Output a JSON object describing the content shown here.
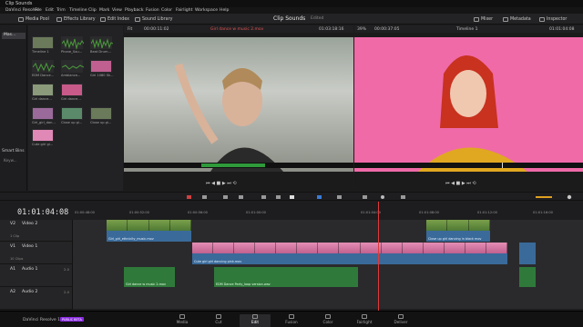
{
  "window": {
    "title": "Clip Sounds"
  },
  "menu": [
    "DaVinci Resolve",
    "File",
    "Edit",
    "Trim",
    "Timeline",
    "Clip",
    "Mark",
    "View",
    "Playback",
    "Fusion",
    "Color",
    "Fairlight",
    "Workspace",
    "Help"
  ],
  "toolbar": {
    "media_pool": "Media Pool",
    "effects_library": "Effects Library",
    "edit_index": "Edit Index",
    "sound_library": "Sound Library",
    "project_title": "Clip Sounds",
    "edited": "Edited",
    "mixer": "Mixer",
    "metadata": "Metadata",
    "inspector": "Inspector"
  },
  "media_pool": {
    "bin_label": "Mas...",
    "smart_bins": "Smart Bins",
    "keywords": "Keyw...",
    "clips": [
      {
        "label": "Timeline 1",
        "color": "#6b7a5a"
      },
      {
        "label": "Phone_Sou...",
        "color": "#4a8a3a"
      },
      {
        "label": "Beat Drum...",
        "color": "#4a8a3a"
      },
      {
        "label": "Girl 1080 Sk...",
        "color": "#c06090"
      },
      {
        "label": "EDM Dance...",
        "color": "#4a8a3a"
      },
      {
        "label": "Ambiance...",
        "color": "#5a6a4a"
      },
      {
        "label": "Girl dance...",
        "color": "#8a9a7a"
      },
      {
        "label": "Girl dance...",
        "color": "#c85a8a"
      },
      {
        "label": "Girl_girl_dan...",
        "color": "#9a6a9a"
      },
      {
        "label": "Close up gi...",
        "color": "#5a8a6a"
      },
      {
        "label": "Close up gi...",
        "color": "#6a7a5a"
      },
      {
        "label": "Cute girl gi...",
        "color": "#e088b6"
      }
    ]
  },
  "source_viewer": {
    "zoom": "Fit",
    "tc_in": "00:00:11:02",
    "clip_name": "Girl dance w music 2.mov",
    "tc_out": "01:03:18:16"
  },
  "timeline_viewer": {
    "zoom": "39%",
    "tc_in": "00:00:37:05",
    "timeline_name": "Timeline 1",
    "tc_out": "01:01:04:08"
  },
  "timeline": {
    "timecode": "01:01:04:08",
    "ruler": [
      "01:00:48:00",
      "01:00:52:00",
      "01:00:56:00",
      "01:01:00:00",
      "01:01:04:00",
      "01:01:08:00",
      "01:01:12:00",
      "01:01:16:00"
    ],
    "tracks": [
      {
        "code": "V2",
        "name": "Video 2",
        "count": "1 Clip",
        "num": ""
      },
      {
        "code": "V1",
        "name": "Video 1",
        "count": "10 Clips",
        "num": ""
      },
      {
        "code": "A1",
        "name": "Audio 1",
        "count": "",
        "num": "2.0"
      },
      {
        "code": "A2",
        "name": "Audio 2",
        "count": "",
        "num": "2.0"
      }
    ],
    "clips": {
      "v2a": "Girl_girl_ethnicity_music.mov",
      "v2b": "Close up girl dancing in black mov",
      "v1": "Cute girl girl dancing pink.mov",
      "a1a": "Girl dance w music 2.mov",
      "a1b": "EDM Dance Party_loop version.wav"
    }
  },
  "pages": [
    "Media",
    "Cut",
    "Edit",
    "Fusion",
    "Color",
    "Fairlight",
    "Deliver"
  ],
  "active_page": "Edit",
  "brand": {
    "name": "DaVinci Resolve 16",
    "badge": "PUBLIC BETA"
  }
}
